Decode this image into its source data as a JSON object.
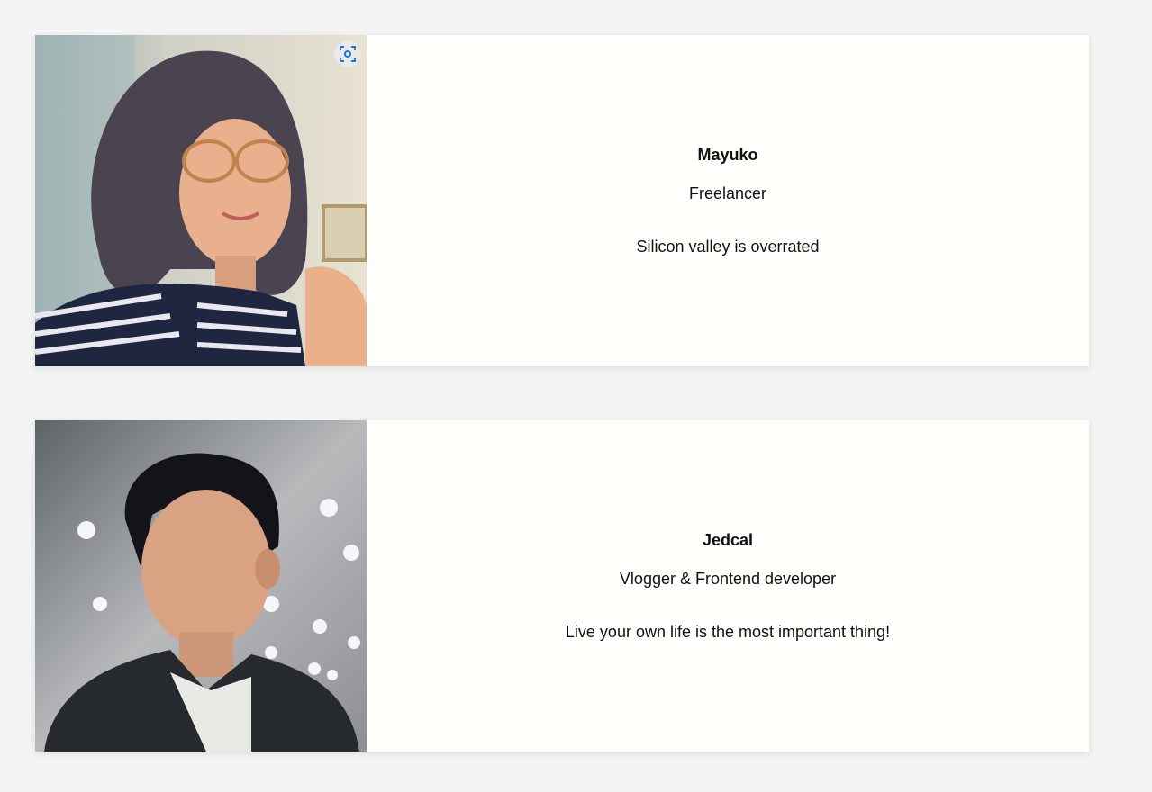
{
  "profiles": [
    {
      "name": "Mayuko",
      "role": "Freelancer",
      "quote": "Silicon valley is overrated",
      "photo_icon": "visual-search-icon"
    },
    {
      "name": "Jedcal",
      "role": "Vlogger & Frontend developer",
      "quote": "Live your own life is the most important thing!"
    }
  ],
  "colors": {
    "page_bg": "#f4f4f5",
    "card_bg": "#fffffc",
    "accent_icon": "#1a73e8"
  }
}
